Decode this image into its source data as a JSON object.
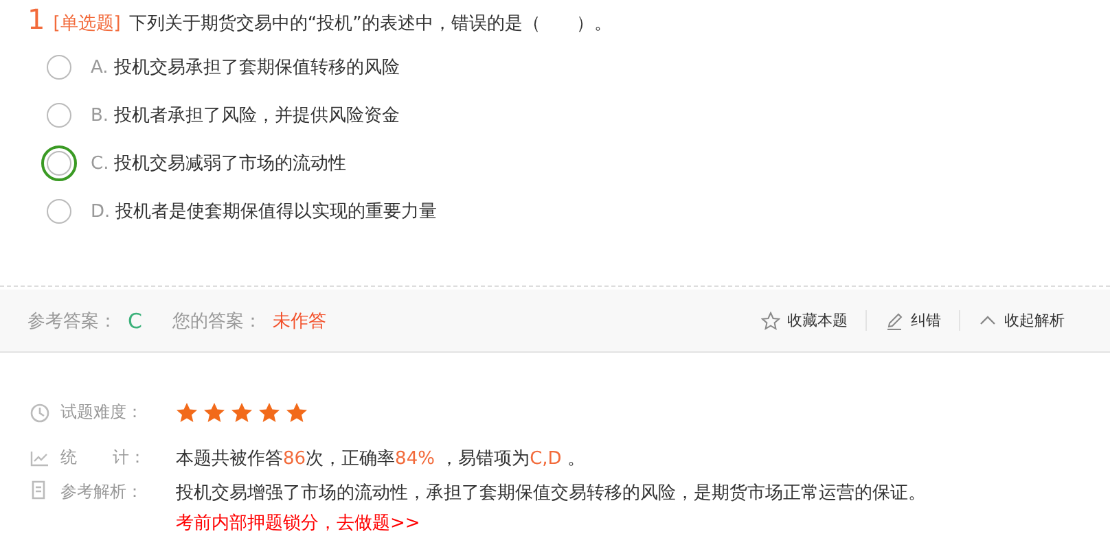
{
  "question": {
    "number": "1",
    "type_tag": "[单选题]",
    "text": "下列关于期货交易中的“投机”的表述中，错误的是（　　）。"
  },
  "options": [
    {
      "letter": "A.",
      "text": "投机交易承担了套期保值转移的风险",
      "correct": false
    },
    {
      "letter": "B.",
      "text": "投机者承担了风险，并提供风险资金",
      "correct": false
    },
    {
      "letter": "C.",
      "text": "投机交易减弱了市场的流动性",
      "correct": true
    },
    {
      "letter": "D.",
      "text": "投机者是使套期保值得以实现的重要力量",
      "correct": false
    }
  ],
  "answer_bar": {
    "reference_label": "参考答案：",
    "reference_answer": "C",
    "your_label": "您的答案：",
    "your_answer": "未作答",
    "actions": [
      {
        "kind": "star",
        "label": "收藏本题"
      },
      {
        "kind": "pencil",
        "label": "纠错"
      },
      {
        "kind": "caret",
        "label": "收起解析"
      }
    ]
  },
  "analysis": {
    "difficulty_label": "试题难度：",
    "stars": 5,
    "stats_label": [
      "统",
      "计："
    ],
    "stats": [
      {
        "kind": "plain",
        "text": "本题共被作答"
      },
      {
        "kind": "highlight",
        "text": "86"
      },
      {
        "kind": "plain",
        "text": "次，正确率"
      },
      {
        "kind": "highlight",
        "text": "84%"
      },
      {
        "kind": "plain",
        "text": " ，易错项为"
      },
      {
        "kind": "highlight",
        "text": "C,D"
      },
      {
        "kind": "plain",
        "text": " 。"
      }
    ],
    "explanation_label": "参考解析：",
    "explanation": "投机交易增强了市场的流动性，承担了套期保值交易转移的风险，是期货市场正常运营的保证。",
    "promo_link": "考前内部押题锁分，去做题>>"
  }
}
